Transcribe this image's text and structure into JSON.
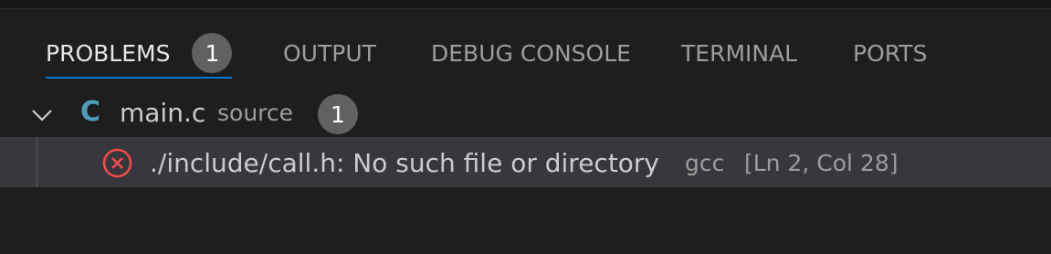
{
  "tabs": [
    {
      "label": "PROBLEMS",
      "badge": "1",
      "active": true
    },
    {
      "label": "OUTPUT"
    },
    {
      "label": "DEBUG CONSOLE"
    },
    {
      "label": "TERMINAL"
    },
    {
      "label": "PORTS"
    }
  ],
  "file": {
    "icon": "C",
    "name": "main.c",
    "source": "source",
    "count": "1"
  },
  "problem": {
    "severity": "error",
    "message": "./include/call.h: No such file or directory",
    "source": "gcc",
    "location": "[Ln 2, Col 28]"
  },
  "colors": {
    "background": "#1e1e1e",
    "active_tab_underline": "#0078d4",
    "badge": "#616161",
    "c_icon": "#519aba",
    "error": "#f14c4c",
    "selected_row": "#37373d"
  },
  "icons": {
    "tree_toggle": "chevron-down-icon",
    "file_type": "c-file-icon",
    "severity": "error-circle-icon"
  }
}
